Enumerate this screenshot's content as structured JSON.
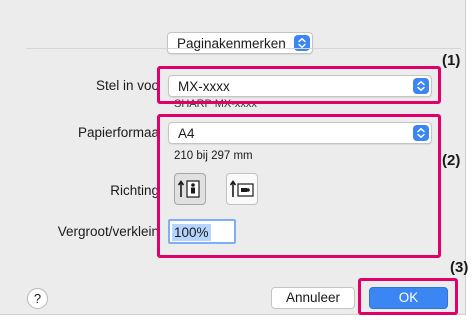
{
  "dialog": {
    "section_popup": "Paginakenmerken",
    "printer": {
      "label": "Stel in voo",
      "value": "MX-xxxx",
      "subtitle": "SHARP MX-xxxx"
    },
    "paper": {
      "label": "Papierformaa",
      "value": "A4",
      "size_text": "210 bij 297 mm"
    },
    "orientation": {
      "label": "Richting",
      "selected": "portrait",
      "options": [
        "portrait",
        "landscape"
      ]
    },
    "scale": {
      "label": "Vergroot/verklein",
      "value": "100%"
    },
    "buttons": {
      "help": "?",
      "cancel": "Annuleer",
      "ok": "OK"
    }
  },
  "callouts": [
    "(1)",
    "(2)",
    "(3)"
  ],
  "colors": {
    "accent": "#3b86f2",
    "callout_border": "#e0006a",
    "dialog_bg": "#ececec"
  }
}
